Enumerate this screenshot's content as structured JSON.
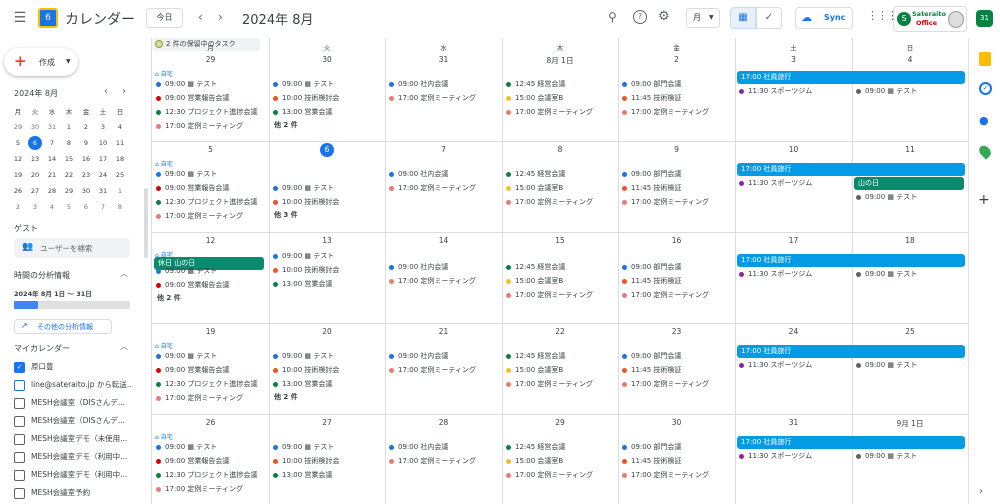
{
  "header": {
    "app_title": "カレンダー",
    "logo_day": "6",
    "today_label": "今日",
    "period": "2024年 8月",
    "view_select": "月",
    "sync_label": "Sync",
    "brand_line1": "Sateraito",
    "brand_line2": "Office",
    "account_badge": "31"
  },
  "sidebar": {
    "create_label": "作成",
    "mini_title": "2024年 8月",
    "weekdays": [
      "月",
      "火",
      "水",
      "木",
      "金",
      "土",
      "日"
    ],
    "mini_days": [
      [
        "29",
        "30",
        "31",
        "1",
        "2",
        "3",
        "4"
      ],
      [
        "5",
        "6",
        "7",
        "8",
        "9",
        "10",
        "11"
      ],
      [
        "12",
        "13",
        "14",
        "15",
        "16",
        "17",
        "18"
      ],
      [
        "19",
        "20",
        "21",
        "22",
        "23",
        "24",
        "25"
      ],
      [
        "26",
        "27",
        "28",
        "29",
        "30",
        "31",
        "1"
      ],
      [
        "2",
        "3",
        "4",
        "5",
        "6",
        "7",
        "8"
      ]
    ],
    "guest_heading": "ゲスト",
    "search_users": "ユーザーを検索",
    "time_heading": "時間の分析情報",
    "time_range": "2024年 8月 1日 〜 31日",
    "more_insights": "その他の分析情報",
    "my_cals_heading": "マイカレンダー",
    "calendars": [
      {
        "name": "原口豊",
        "checked": true
      },
      {
        "name": "line@sateraito.jp から転送..",
        "checked": false
      },
      {
        "name": "MESH会議室（DISさんデ...",
        "checked": false
      },
      {
        "name": "MESH会議室（DISさんデ...",
        "checked": false
      },
      {
        "name": "MESH会議室デモ（未使用...",
        "checked": false
      },
      {
        "name": "MESH会議室デモ（利用中...",
        "checked": false
      },
      {
        "name": "MESH会議室デモ（利用中...",
        "checked": false
      },
      {
        "name": "MESH会議室予約",
        "checked": false
      }
    ]
  },
  "calendar": {
    "weekdays": [
      "月",
      "火",
      "水",
      "木",
      "金",
      "土",
      "日"
    ],
    "home_tag": "自宅",
    "weeks": [
      {
        "days": [
          "29",
          "30",
          "31",
          "8月 1日",
          "1",
          "2",
          "3",
          "4"
        ],
        "more_mon": "",
        "more_tue": "他 2 件",
        "bar": "17:00 社員旅行",
        "holiday": ""
      },
      {
        "days": [
          "5",
          "6",
          "7",
          "8",
          "9",
          "10",
          "11"
        ],
        "more_mon": "",
        "more_tue": "他 3 件",
        "bar": "17:00 社員旅行",
        "holiday": "山の日"
      },
      {
        "days": [
          "12",
          "13",
          "14",
          "15",
          "16",
          "17",
          "18"
        ],
        "more_mon": "他 2 件",
        "more_tue": "",
        "bar": "17:00 社員旅行",
        "holiday": "休日 山の日"
      },
      {
        "days": [
          "19",
          "20",
          "21",
          "22",
          "23",
          "24",
          "25"
        ],
        "more_mon": "",
        "more_tue": "他 2 件",
        "bar": "17:00 社員旅行",
        "holiday": ""
      },
      {
        "days": [
          "26",
          "27",
          "28",
          "29",
          "30",
          "31",
          "9月 1日"
        ],
        "more_mon": "",
        "more_tue": "",
        "bar": "17:00 社員旅行",
        "holiday": ""
      }
    ],
    "day_labels": {
      "w1": [
        "29",
        "30",
        "31",
        "8月 1日",
        "2",
        "3",
        "4"
      ],
      "w2": [
        "5",
        "6",
        "7",
        "8",
        "9",
        "10",
        "11"
      ],
      "w3": [
        "12",
        "13",
        "14",
        "15",
        "16",
        "17",
        "18"
      ],
      "w4": [
        "19",
        "20",
        "21",
        "22",
        "23",
        "24",
        "25"
      ],
      "w5": [
        "26",
        "27",
        "28",
        "29",
        "30",
        "31",
        "9月 1日"
      ]
    },
    "ev": {
      "test": "09:00 ▦ テスト",
      "eigyo": "09:00 営業報告会議",
      "project": "12:30 プロジェクト進捗会議",
      "teirei": "17:00 定例ミーティング",
      "gijutsu": "10:00 技術検討会",
      "eigyokai": "13:00 営業会議",
      "shanai": "09:00 社内会議",
      "keiei": "12:45 経営会議",
      "kaigiB": "15:00 会議室B",
      "bumon": "09:00 部門会議",
      "kensho": "11:45 技術検証",
      "sports": "11:30 スポーツジム",
      "pending": "2 件の保留中のタスク"
    }
  },
  "colors": {
    "blue": "#1a73e8",
    "red": "#d50000",
    "green": "#0b8043",
    "orange": "#f4511e",
    "salmon": "#e67c73",
    "yellow": "#f6bf26",
    "purple": "#8e24aa",
    "gray": "#616161",
    "teal": "#0b8a6e",
    "barblue": "#039be5"
  }
}
